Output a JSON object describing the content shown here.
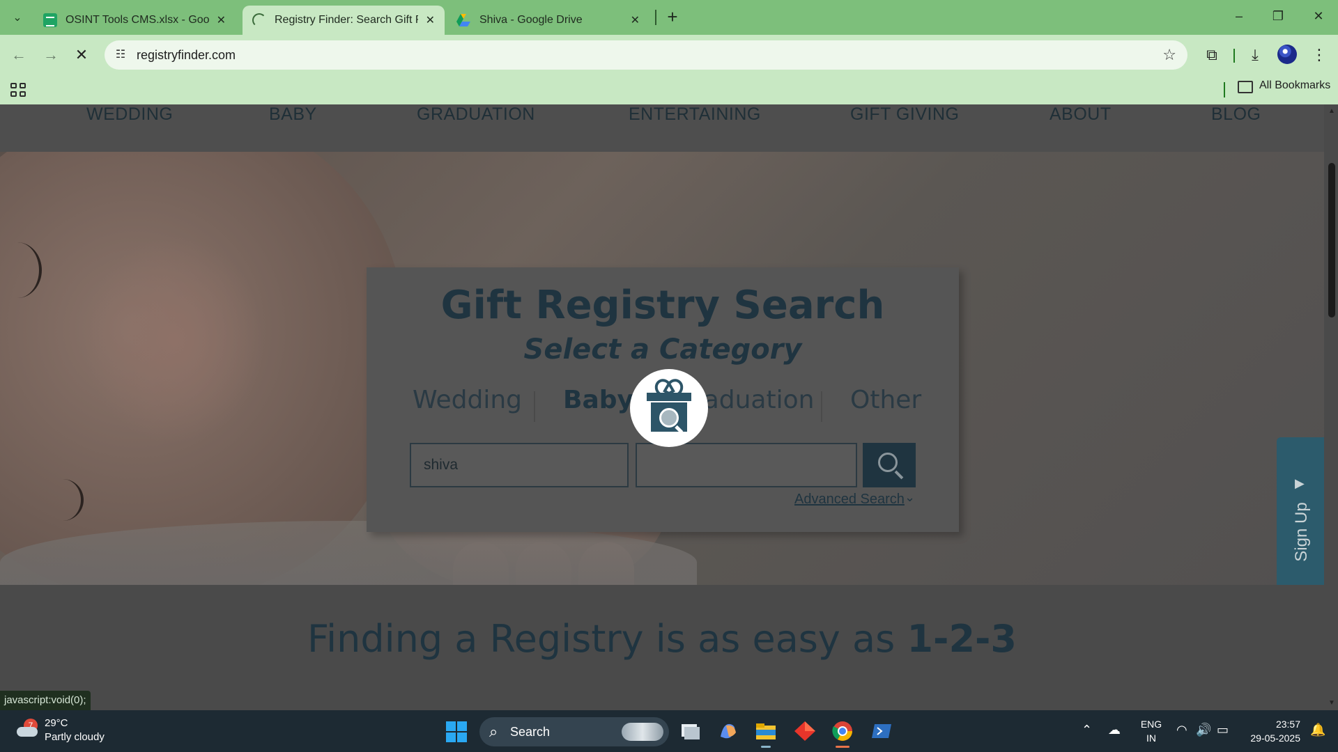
{
  "browser": {
    "tabs": [
      {
        "title": "OSINT Tools CMS.xlsx - Google",
        "icon": "sheets-icon",
        "active": false
      },
      {
        "title": "Registry Finder: Search Gift Reg",
        "icon": "loading-icon",
        "active": true
      },
      {
        "title": "Shiva - Google Drive",
        "icon": "drive-icon",
        "active": false
      }
    ],
    "url": "registryfinder.com",
    "bookmarks_label": "All Bookmarks",
    "status_url": "javascript:void(0);"
  },
  "site": {
    "nav": [
      "WEDDING",
      "BABY",
      "GRADUATION",
      "ENTERTAINING",
      "GIFT GIVING",
      "ABOUT",
      "BLOG"
    ],
    "search": {
      "title": "Gift Registry Search",
      "subtitle": "Select a Category",
      "categories": [
        "Wedding",
        "Baby",
        "Graduation",
        "Other"
      ],
      "selected_category": "Baby",
      "first_name_value": "shiva",
      "last_name_value": "",
      "advanced_label": "Advanced Search"
    },
    "signup_label": "Sign Up",
    "steps_heading_prefix": "Finding a Registry is as easy as ",
    "steps_heading_bold": "1-2-3"
  },
  "taskbar": {
    "weather_badge": "7",
    "weather_temp": "29°C",
    "weather_desc": "Partly cloudy",
    "search_label": "Search",
    "lang_top": "ENG",
    "lang_bottom": "IN",
    "time": "23:57",
    "date": "29-05-2025"
  },
  "colors": {
    "tab_strip": "#7dbf7b",
    "toolbar": "#c8e8c3",
    "brand_dark": "#1f3440",
    "signup": "#2c5b6c",
    "taskbar": "#1d2a33"
  }
}
